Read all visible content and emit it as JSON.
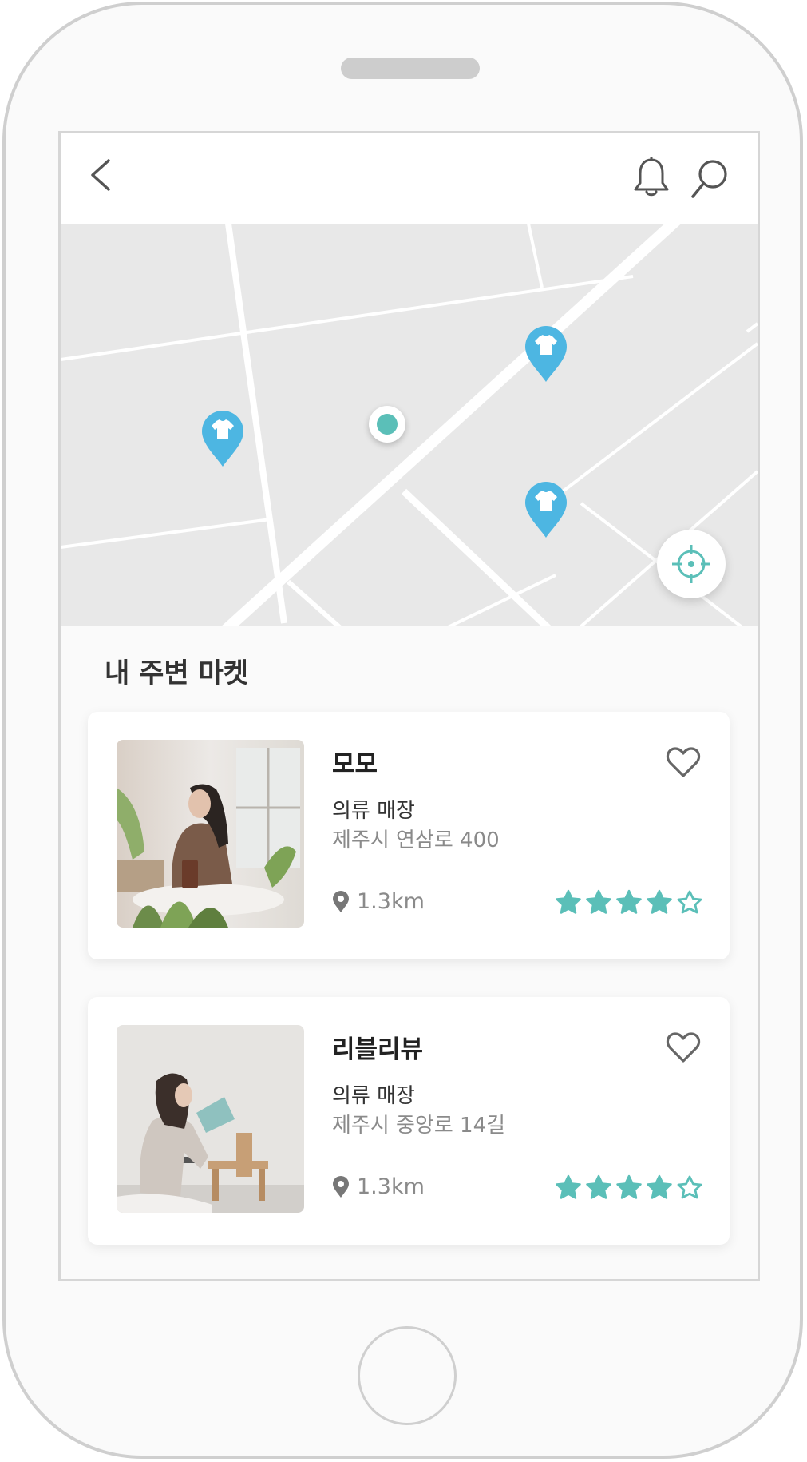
{
  "header": {
    "back_icon": "chevron-left-icon",
    "notification_icon": "bell-icon",
    "search_icon": "search-icon"
  },
  "map": {
    "markers": [
      {
        "type": "clothing-store",
        "icon": "tshirt-icon",
        "color": "#4db6e2"
      },
      {
        "type": "clothing-store",
        "icon": "tshirt-icon",
        "color": "#4db6e2"
      },
      {
        "type": "clothing-store",
        "icon": "tshirt-icon",
        "color": "#4db6e2"
      }
    ],
    "user_location_color": "#5bbfb8",
    "locate_icon": "crosshair-icon"
  },
  "section": {
    "title": "내 주변 마켓"
  },
  "stores": [
    {
      "name": "모모",
      "category": "의류 매장",
      "address": "제주시 연삼로 400",
      "distance": "1.3km",
      "rating": 4,
      "rating_max": 5,
      "favorite": false
    },
    {
      "name": "리블리뷰",
      "category": "의류 매장",
      "address": "제주시 중앙로 14길",
      "distance": "1.3km",
      "rating": 4,
      "rating_max": 5,
      "favorite": false
    }
  ],
  "colors": {
    "accent": "#5bbfb8",
    "marker": "#4db6e2",
    "icon_gray": "#555555"
  }
}
